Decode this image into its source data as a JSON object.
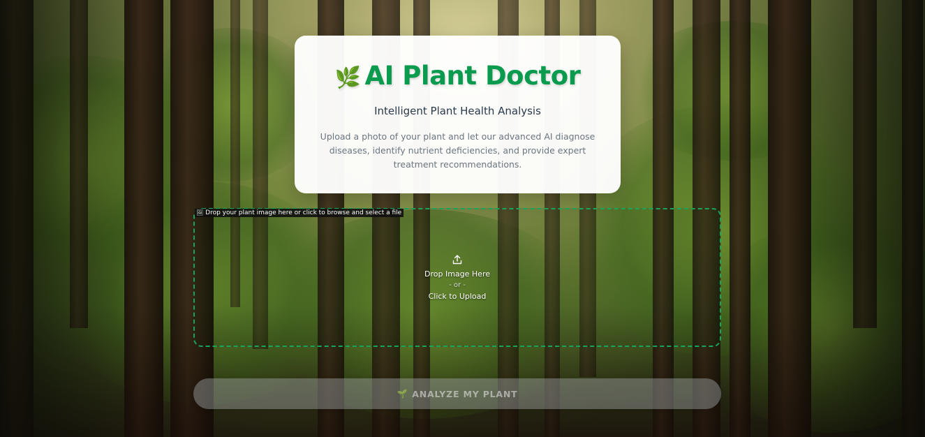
{
  "hero": {
    "icon": "leaf-icon",
    "title": "AI Plant Doctor",
    "subtitle": "Intelligent Plant Health Analysis",
    "description": "Upload a photo of your plant and let our advanced AI diagnose diseases, identify nutrient deficiencies, and provide expert treatment recommendations."
  },
  "dropzone": {
    "tooltip": "Drop your plant image here or click to browse and select a file",
    "icon": "upload-icon",
    "drop_label": "Drop Image Here",
    "or_label": "- or -",
    "click_label": "Click to Upload"
  },
  "analyze_button": {
    "icon": "seedling-icon",
    "label": "ANALYZE MY PLANT",
    "enabled": false
  },
  "colors": {
    "accent": "#0a9b4e",
    "dropzone_border": "#1aa35a",
    "card_bg": "#ffffff"
  }
}
